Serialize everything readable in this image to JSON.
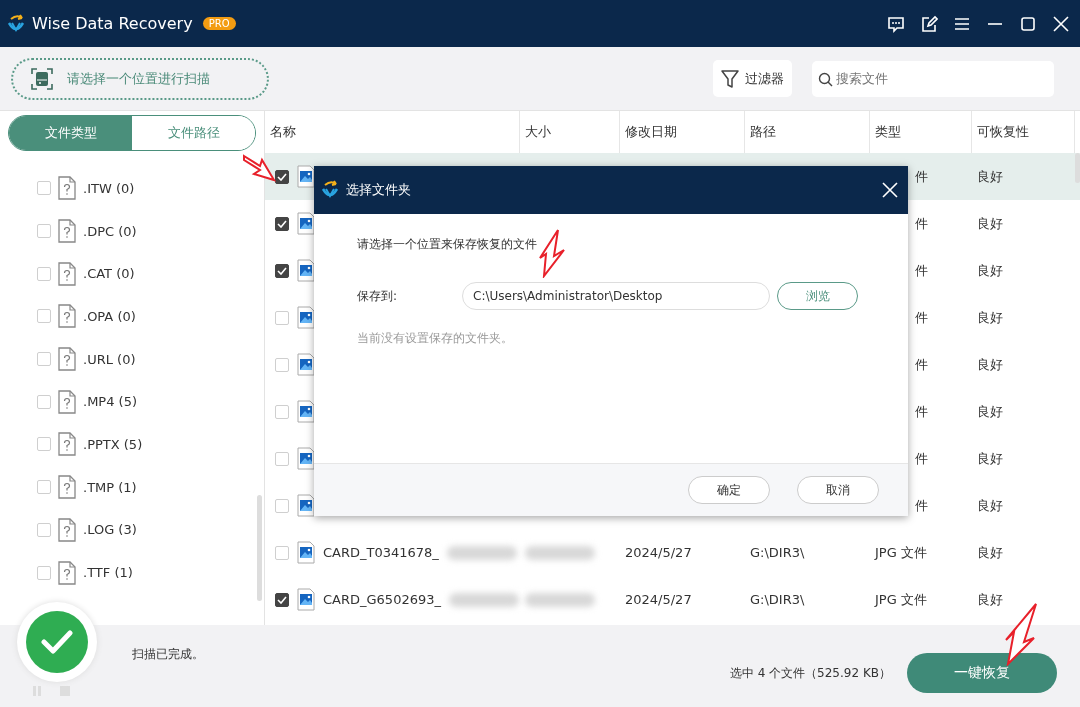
{
  "window": {
    "title": "Wise Data Recovery",
    "badge": "PRO"
  },
  "toolbar": {
    "scan_location": "请选择一个位置进行扫描",
    "filter": "过滤器",
    "search": {
      "placeholder": "搜索文件"
    }
  },
  "sidebar": {
    "tabs": [
      {
        "label": "文件类型",
        "selected": true
      },
      {
        "label": "文件路径",
        "selected": false
      }
    ],
    "items": [
      {
        "label": ".ITW (0)",
        "checked": false
      },
      {
        "label": ".DPC (0)",
        "checked": false
      },
      {
        "label": ".CAT (0)",
        "checked": false
      },
      {
        "label": ".OPA (0)",
        "checked": false
      },
      {
        "label": ".URL (0)",
        "checked": false
      },
      {
        "label": ".MP4 (5)",
        "checked": false
      },
      {
        "label": ".PPTX (5)",
        "checked": false
      },
      {
        "label": ".TMP (1)",
        "checked": false
      },
      {
        "label": ".LOG (3)",
        "checked": false
      },
      {
        "label": ".TTF (1)",
        "checked": false
      }
    ]
  },
  "table": {
    "columns": [
      "名称",
      "大小",
      "修改日期",
      "路径",
      "类型",
      "可恢复性"
    ],
    "rows": [
      {
        "selected": true,
        "checked": true,
        "type": "件",
        "recoverability": "良好"
      },
      {
        "selected": false,
        "checked": true,
        "type": "件",
        "recoverability": "良好"
      },
      {
        "selected": false,
        "checked": true,
        "type": "件",
        "recoverability": "良好"
      },
      {
        "selected": false,
        "checked": false,
        "type": "件",
        "recoverability": "良好"
      },
      {
        "selected": false,
        "checked": false,
        "type": "件",
        "recoverability": "良好"
      },
      {
        "selected": false,
        "checked": false,
        "type": "件",
        "recoverability": "良好"
      },
      {
        "selected": false,
        "checked": false,
        "type": "件",
        "recoverability": "良好"
      },
      {
        "selected": false,
        "checked": false,
        "type": "件",
        "recoverability": "良好"
      },
      {
        "selected": false,
        "checked": false,
        "name": "CARD_T0341678_",
        "date": "2024/5/27",
        "path": "G:\\DIR3\\",
        "type": "JPG 文件",
        "recoverability": "良好"
      },
      {
        "selected": false,
        "checked": true,
        "name": "CARD_G6502693_",
        "date": "2024/5/27",
        "path": "G:\\DIR3\\",
        "type": "JPG 文件",
        "recoverability": "良好"
      }
    ]
  },
  "dialog": {
    "title": "选择文件夹",
    "prompt": "请选择一个位置来保存恢复的文件",
    "save_label": "保存到:",
    "save_path": "C:\\Users\\Administrator\\Desktop",
    "browse": "浏览",
    "note": "当前没有设置保存的文件夹。",
    "buttons": [
      "确定",
      "取消"
    ]
  },
  "status_bar": {
    "message": "扫描已完成。",
    "selection": "选中 4 个文件（525.92 KB）",
    "recover_button": "一键恢复"
  }
}
